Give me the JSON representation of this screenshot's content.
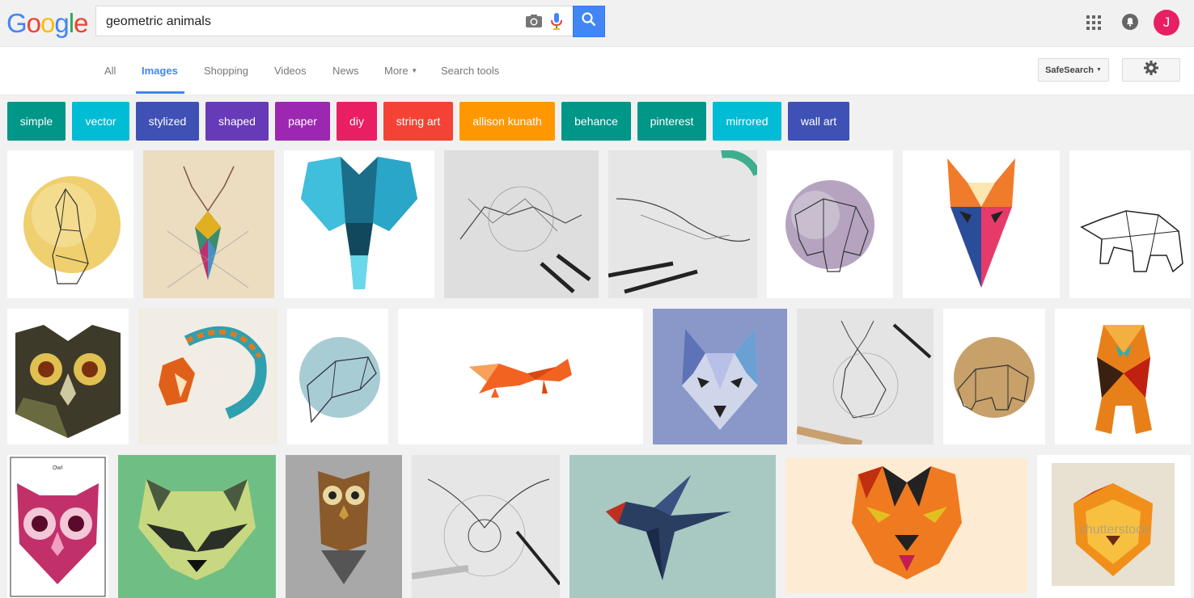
{
  "logo": {
    "letters": [
      "G",
      "o",
      "o",
      "g",
      "l",
      "e"
    ]
  },
  "search": {
    "query": "geometric animals",
    "button_icon": "search-icon"
  },
  "account": {
    "initial": "J"
  },
  "nav": {
    "tabs": [
      "All",
      "Images",
      "Shopping",
      "Videos",
      "News",
      "More",
      "Search tools"
    ],
    "active_tab": "Images",
    "safesearch_label": "SafeSearch"
  },
  "chips": [
    {
      "label": "simple",
      "color": "#009688"
    },
    {
      "label": "vector",
      "color": "#00bcd4"
    },
    {
      "label": "stylized",
      "color": "#3f51b5"
    },
    {
      "label": "shaped",
      "color": "#673ab7"
    },
    {
      "label": "paper",
      "color": "#9c27b0"
    },
    {
      "label": "diy",
      "color": "#e91e63"
    },
    {
      "label": "string art",
      "color": "#f44336"
    },
    {
      "label": "allison kunath",
      "color": "#ff9800"
    },
    {
      "label": "behance",
      "color": "#009688"
    },
    {
      "label": "pinterest",
      "color": "#009688"
    },
    {
      "label": "mirrored",
      "color": "#00bcd4"
    },
    {
      "label": "wall art",
      "color": "#3f51b5"
    }
  ],
  "results": {
    "row1": [
      "watercolor-wolf",
      "geometric-deer",
      "blue-elephant",
      "sketch-fox",
      "sketch-whale",
      "watercolor-elephant",
      "orange-fox",
      "line-bear"
    ],
    "row2": [
      "owl-face",
      "feather-fox",
      "watercolor-shark",
      "paper-fox",
      "wolf-face",
      "sketch-deer",
      "watercolor-bear",
      "tiger-walking"
    ],
    "row3": [
      "pink-owl",
      "raccoon-face",
      "brown-owl",
      "sketch-owl",
      "paper-swallow",
      "tiger-face",
      "lion-face"
    ],
    "owl_caption": "Owl",
    "watermark": "shutterstock"
  }
}
